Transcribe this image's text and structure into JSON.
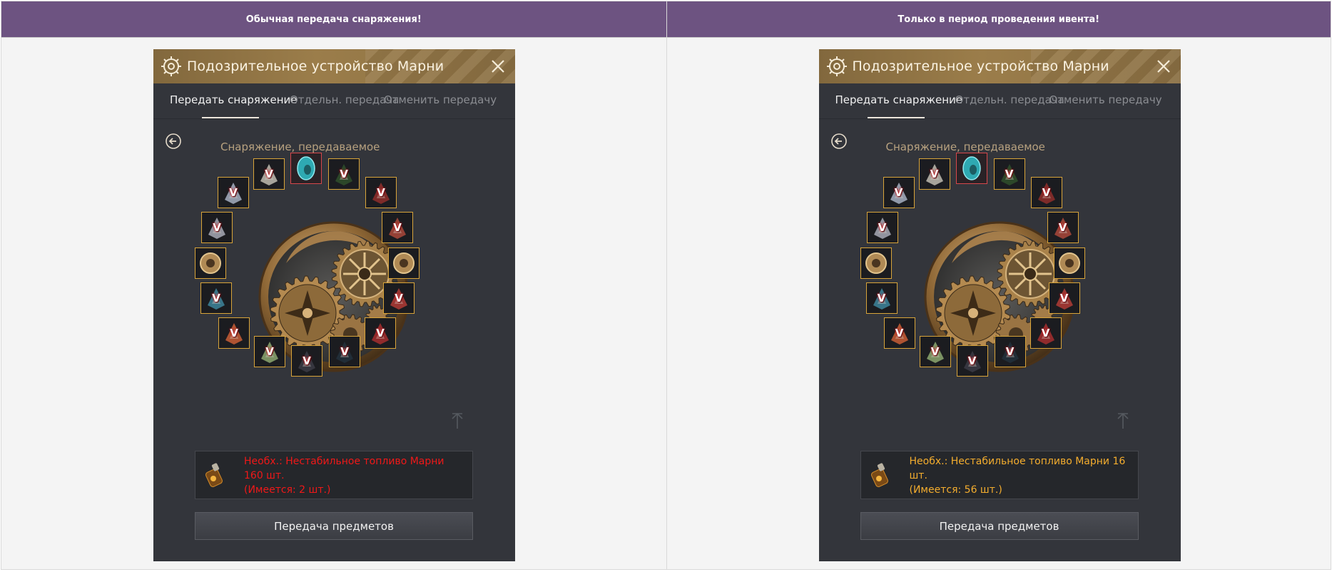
{
  "columns": [
    {
      "header": "Обычная передача снаряжения!",
      "window": {
        "title": "Подозрительное устройство Марни",
        "tabs": [
          {
            "label": "Передать снаряжение",
            "active": true
          },
          {
            "label": "Отдельн. передача",
            "active": false
          },
          {
            "label": "Отменить передачу",
            "active": false
          }
        ],
        "section_label": "Снаряжение, передаваемое",
        "requirement": {
          "line1": "Необх.: Нестабильное топливо Марни",
          "line2": "160 шт.",
          "line3": "(Имеется: 2 шт.)",
          "status": "insufficient",
          "color": "#f01818"
        },
        "transfer_button": "Передача предметов"
      }
    },
    {
      "header": "Только в период проведения ивента!",
      "window": {
        "title": "Подозрительное устройство Марни",
        "tabs": [
          {
            "label": "Передать снаряжение",
            "active": true
          },
          {
            "label": "Отдельн. передача",
            "active": false
          },
          {
            "label": "Отменить передачу",
            "active": false
          }
        ],
        "section_label": "Снаряжение, передаваемое",
        "requirement": {
          "line1": "Необх.: Нестабильное топливо Марни 16",
          "line2": "шт.",
          "line3": "(Имеется: 56 шт.)",
          "status": "sufficient",
          "color": "#f4ad2e"
        },
        "transfer_button": "Передача предметов"
      }
    }
  ],
  "gear_slots": [
    {
      "name": "slot-helmet",
      "icon": "helmet-icon",
      "badge": "V",
      "selected": false
    },
    {
      "name": "slot-alchemy-stone",
      "icon": "alchemy-stone-icon",
      "badge": "",
      "selected": true
    },
    {
      "name": "slot-armor",
      "icon": "armor-icon",
      "badge": "V",
      "selected": false
    },
    {
      "name": "slot-shoulder",
      "icon": "shoulder-armor-icon",
      "badge": "V",
      "selected": false
    },
    {
      "name": "slot-chest",
      "icon": "chest-armor-icon",
      "badge": "V",
      "selected": false
    },
    {
      "name": "slot-right-ornament",
      "icon": "ornament-icon",
      "badge": "",
      "selected": false
    },
    {
      "name": "slot-claw",
      "icon": "claw-icon",
      "badge": "V",
      "selected": false
    },
    {
      "name": "slot-belt",
      "icon": "belt-icon",
      "badge": "V",
      "selected": false
    },
    {
      "name": "slot-gauntlet-right",
      "icon": "gauntlet-icon",
      "badge": "V",
      "selected": false
    },
    {
      "name": "slot-gloves",
      "icon": "gloves-icon",
      "badge": "V",
      "selected": false
    },
    {
      "name": "slot-shoes",
      "icon": "shoes-icon",
      "badge": "V",
      "selected": false
    },
    {
      "name": "slot-left-ornament",
      "icon": "ornament-icon",
      "badge": "",
      "selected": false
    },
    {
      "name": "slot-leg",
      "icon": "leg-armor-icon",
      "badge": "V",
      "selected": false
    },
    {
      "name": "slot-dagger",
      "icon": "dagger-icon",
      "badge": "V",
      "selected": false
    },
    {
      "name": "slot-sword",
      "icon": "sword-icon",
      "badge": "V",
      "selected": false
    },
    {
      "name": "slot-cannon",
      "icon": "cannon-icon",
      "badge": "V",
      "selected": false
    }
  ],
  "colors": {
    "header_bg": "#6d5381",
    "title_bar": "#9b7d4a",
    "window_bg": "#33353b",
    "slot_border": "#d8a43a",
    "section_label": "#b7a17f"
  }
}
